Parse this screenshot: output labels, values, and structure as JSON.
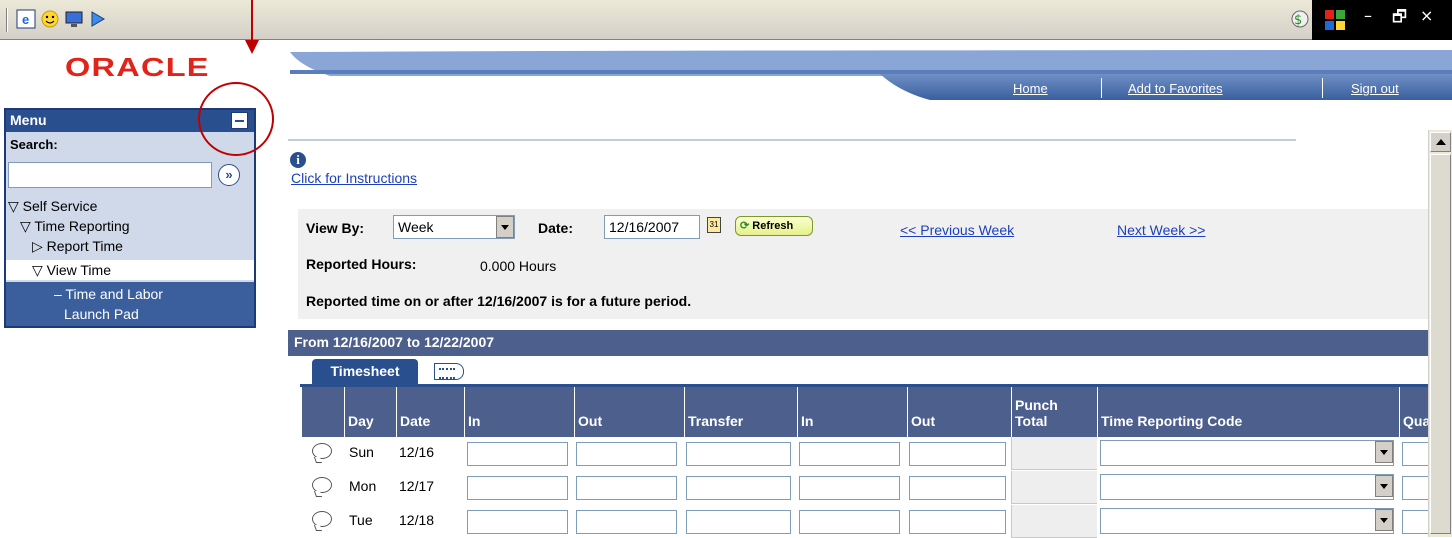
{
  "header": {
    "logo": "ORACLE",
    "links": [
      "Home",
      "Add to Favorites",
      "Sign out"
    ]
  },
  "menu": {
    "title": "Menu",
    "search_label": "Search:",
    "search_value": "",
    "search_go": "»",
    "items": [
      {
        "label": "▽ Self Service"
      },
      {
        "label": "▽ Time Reporting"
      },
      {
        "label": "▷ Report Time"
      },
      {
        "label": "▽ View Time"
      }
    ],
    "launch_line1": "– Time and Labor",
    "launch_line2": "Launch Pad"
  },
  "instructions": {
    "info": "i",
    "link": "Click for Instructions"
  },
  "view": {
    "view_by_label": "View By:",
    "view_by_value": "Week",
    "date_label": "Date:",
    "date_value": "12/16/2007",
    "cal": "31",
    "refresh_label": "Refresh",
    "prev_week": "<< Previous Week",
    "next_week": "Next Week >>",
    "reported_hours_label": "Reported Hours:",
    "reported_hours_value": "0.000 Hours",
    "future_note": "Reported time on or after 12/16/2007 is for a future period."
  },
  "grid": {
    "range": "From 12/16/2007 to 12/22/2007",
    "tab": "Timesheet",
    "headers": [
      "Day",
      "Date",
      "In",
      "Out",
      "Transfer",
      "In",
      "Out",
      "Punch\nTotal",
      "Time Reporting Code",
      "Qua"
    ],
    "rows": [
      {
        "day": "Sun",
        "date": "12/16"
      },
      {
        "day": "Mon",
        "date": "12/17"
      },
      {
        "day": "Tue",
        "date": "12/18"
      }
    ]
  },
  "colors": {
    "annotation": "#c00000",
    "oracle_red": "#e2231a",
    "header_blue": "#2a4f8f",
    "grid_header": "#4d5f8c"
  }
}
